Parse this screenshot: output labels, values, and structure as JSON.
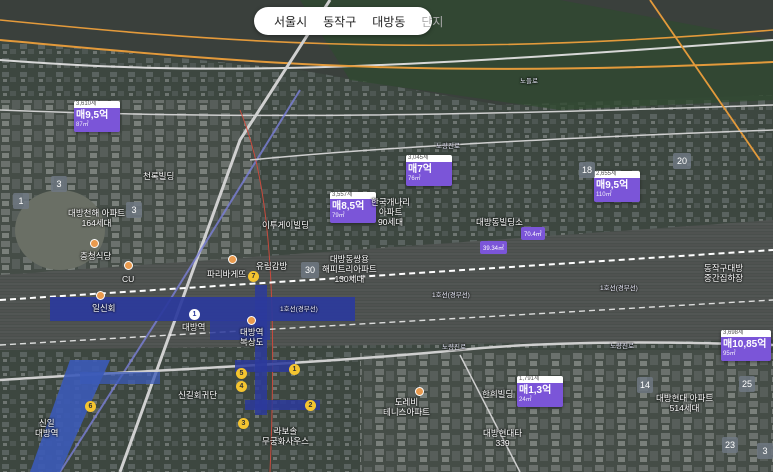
{
  "breadcrumb": {
    "city": "서울시",
    "district": "동작구",
    "neighborhood": "대방동",
    "complex": "단지"
  },
  "colors": {
    "price_marker": "#7b55d8",
    "rail": "#2b3a9c",
    "road": "#e39a3b"
  },
  "icons": {
    "location": "map-pin-icon",
    "dropdown": "chevron-down-icon"
  },
  "price_markers": [
    {
      "households": "3,610세",
      "price": "매9,5억",
      "area": "87㎡"
    },
    {
      "households": "3,557세",
      "price": "매8,5억",
      "area": "79㎡"
    },
    {
      "households": "3,045세",
      "price": "매7억",
      "area": "76㎡"
    },
    {
      "households": "2,655세",
      "price": "매9,5억",
      "area": "110㎡"
    },
    {
      "households": "3,698세",
      "price": "매10,85억",
      "area": "95㎡"
    },
    {
      "households": "1,791세",
      "price": "매1,3억",
      "area": "24㎡"
    }
  ],
  "small_price_markers": [
    "39.34㎡",
    "70.4㎡"
  ],
  "cluster_counts": [
    "1",
    "3",
    "3",
    "30",
    "18",
    "20",
    "14",
    "25",
    "23",
    "3"
  ],
  "places": [
    "천록빌딩",
    "대방천해 아파트\n164세대",
    "충청식당",
    "CU",
    "일신회",
    "파리바게뜨",
    "유림감방",
    "이투게이빌딩",
    "한국개나리\n아파트\n90세대",
    "대방동쌍용\n해피트리아파트\n130세대",
    "대방동빌딩소",
    "대방역",
    "대방역\n복상도",
    "신길회귀단",
    "신일\n대방역",
    "라보솔\n무궁화사우스",
    "도레비\n테니스아파트",
    "한희빌딩",
    "대방현대타\n339",
    "대방현대 아파트\n514세대",
    "동작구대방\n중간집하장"
  ],
  "rail_labels": [
    "1호선(경부선)",
    "1호선(경부선)",
    "1호선(경부선)"
  ],
  "road_labels": [
    "노량진로",
    "노량진로",
    "노량진로",
    "노들로"
  ],
  "station_exits": [
    "1",
    "2",
    "3",
    "4",
    "5",
    "6",
    "7"
  ],
  "station_marker": "1"
}
